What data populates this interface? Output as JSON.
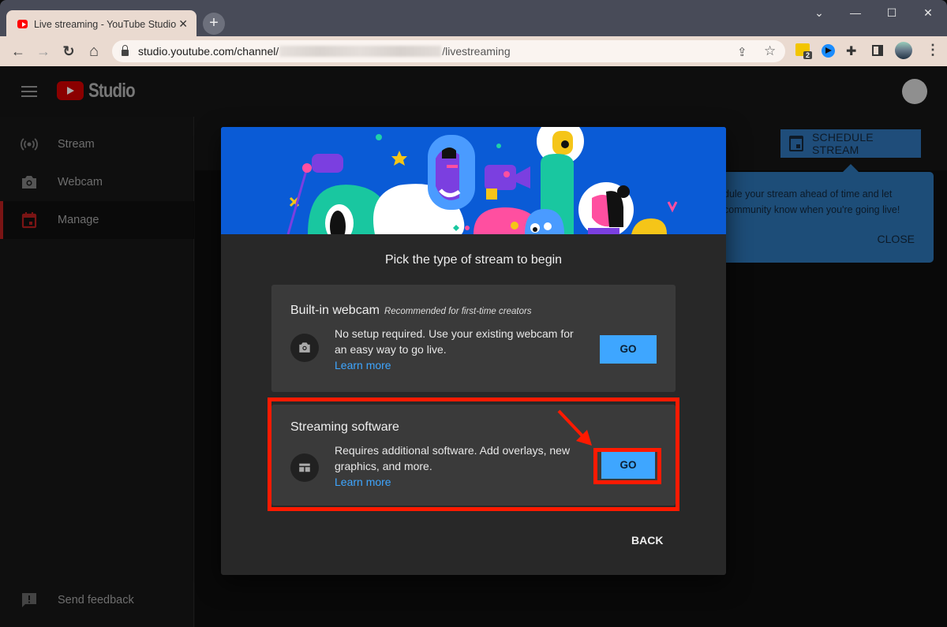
{
  "browser": {
    "tab_title": "Live streaming - YouTube Studio",
    "tab_close": "✕",
    "new_tab": "+",
    "url_host": "studio.youtube.com/channel/",
    "url_path": "/livestreaming",
    "extension_badge": "2",
    "window_controls": {
      "dropdown": "⌄",
      "minimize": "—",
      "maximize": "☐",
      "close": "✕"
    },
    "nav": {
      "back": "←",
      "forward": "→",
      "reload": "↻",
      "home": "⌂",
      "share": "⇪",
      "bookmark": "☆",
      "puzzle": "✚",
      "sidepanel": "▮",
      "menu": "⋮"
    }
  },
  "studio": {
    "logo_text": "Studio",
    "sidebar": {
      "items": [
        {
          "label": "Stream",
          "icon": "broadcast-icon"
        },
        {
          "label": "Webcam",
          "icon": "camera-icon"
        },
        {
          "label": "Manage",
          "icon": "calendar-icon",
          "active": true
        }
      ],
      "feedback_label": "Send feedback"
    },
    "schedule_button": "SCHEDULE STREAM",
    "tooltip": {
      "line1": "dule your stream ahead of time and let",
      "line2": "community know when you're going live!",
      "close": "CLOSE"
    }
  },
  "dialog": {
    "title": "Pick the type of stream to begin",
    "options": [
      {
        "title": "Built-in webcam",
        "subtitle": "Recommended for first-time creators",
        "description": "No setup required. Use your existing webcam for an easy way to go live.",
        "link": "Learn more",
        "button": "GO",
        "icon": "camera-icon"
      },
      {
        "title": "Streaming software",
        "subtitle": "",
        "description": "Requires additional software. Add overlays, new graphics, and more.",
        "link": "Learn more",
        "button": "GO",
        "icon": "encoder-layout-icon",
        "highlighted": true
      }
    ],
    "back_button": "BACK"
  },
  "colors": {
    "hero_bg": "#0a5bd6",
    "go_button": "#3ea6ff",
    "link": "#3ea6ff",
    "highlight": "#ff1a00"
  }
}
